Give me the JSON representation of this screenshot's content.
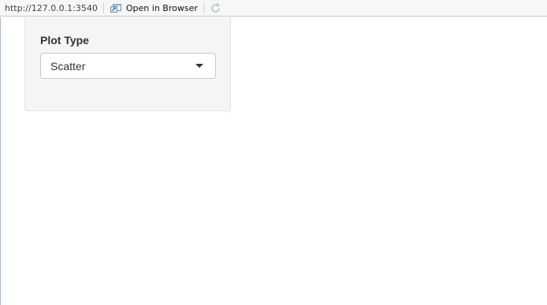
{
  "toolbar": {
    "url": "http://127.0.0.1:3540",
    "open_in_browser": "Open in Browser"
  },
  "sidebar": {
    "plot_type_label": "Plot Type",
    "plot_type_select": {
      "selected": "Scatter"
    }
  }
}
